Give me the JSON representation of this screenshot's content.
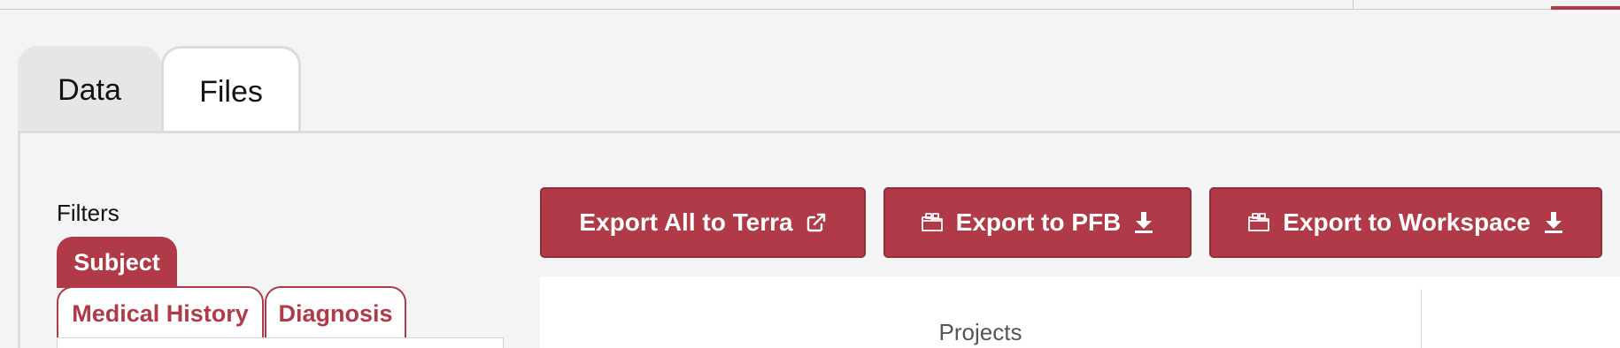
{
  "tabs": [
    {
      "label": "Data",
      "active": false
    },
    {
      "label": "Files",
      "active": true
    }
  ],
  "filters": {
    "title": "Filters",
    "top_tab": "Subject",
    "sub_tabs": [
      "Medical History",
      "Diagnosis"
    ]
  },
  "actions": {
    "export_terra": {
      "label": "Export All to Terra",
      "icon": "external-link-icon"
    },
    "export_pfb": {
      "label": "Export to PFB",
      "icon": "download-icon",
      "leading_icon": "folder-icon"
    },
    "export_workspace": {
      "label": "Export to Workspace",
      "icon": "download-icon",
      "leading_icon": "folder-icon"
    }
  },
  "summary": {
    "projects_label": "Projects"
  },
  "colors": {
    "accent": "#b03a47",
    "background": "#f4f4f4"
  }
}
